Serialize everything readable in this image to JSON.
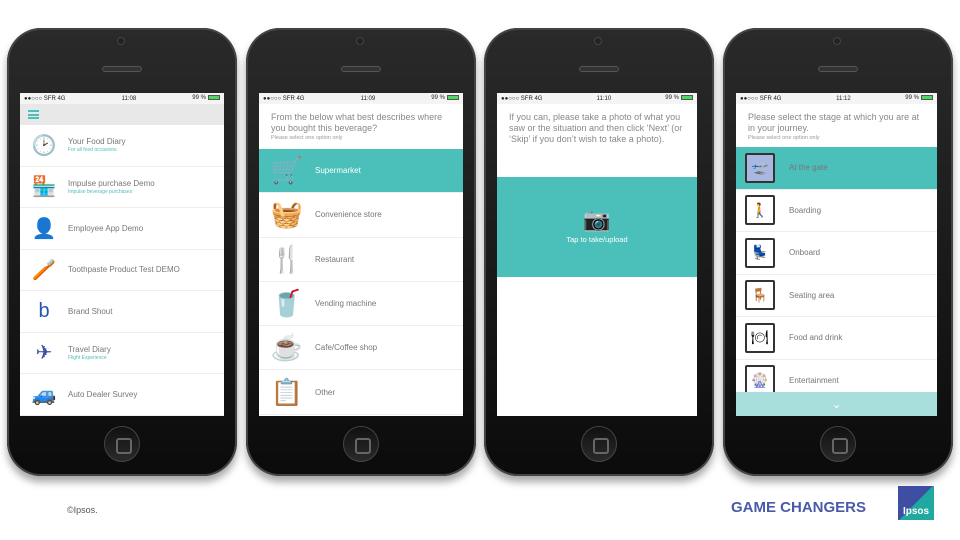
{
  "phones": [
    {
      "status": {
        "carrier": "●●○○○ SFR  4G",
        "time": "11:08",
        "battery": "99 %"
      }
    },
    {
      "status": {
        "carrier": "●●○○○ SFR  4G",
        "time": "11:09",
        "battery": "99 %"
      }
    },
    {
      "status": {
        "carrier": "●●○○○ SFR  4G",
        "time": "11:10",
        "battery": "99 %"
      }
    },
    {
      "status": {
        "carrier": "●●○○○ SFR  4G",
        "time": "11:12",
        "battery": "99 %"
      }
    }
  ],
  "projects": [
    {
      "title": "Your Food Diary",
      "subtitle": "For all food occasions",
      "icon": "clock-icon",
      "glyph": "🕑",
      "color": "#3e4fa3"
    },
    {
      "title": "Impulse purchase Demo",
      "subtitle": "Impulse beverage purchases",
      "icon": "shop-icon",
      "glyph": "🏪",
      "color": "#2b9b9a"
    },
    {
      "title": "Employee App Demo",
      "subtitle": "",
      "icon": "employee-icon",
      "glyph": "👤",
      "color": "#3e4fa3"
    },
    {
      "title": "Toothpaste Product Test DEMO",
      "subtitle": "",
      "icon": "toothbrush-icon",
      "glyph": "🪥",
      "color": "#44c23a"
    },
    {
      "title": "Brand Shout",
      "subtitle": "",
      "icon": "brand-shout-icon",
      "glyph": "b",
      "color": "#2456a8"
    },
    {
      "title": "Travel Diary",
      "subtitle": "Flight Experience",
      "icon": "plane-icon",
      "glyph": "✈",
      "color": "#3e4fa3"
    },
    {
      "title": "Auto Dealer Survey",
      "subtitle": "",
      "icon": "car-icon",
      "glyph": "🚙",
      "color": "#1e6bb8"
    }
  ],
  "purchase": {
    "question": "From the below what best describes where you bought this beverage?",
    "hint": "Please select one option only",
    "options": [
      {
        "label": "Supermarket",
        "icon": "shopping-cart-icon",
        "glyph": "🛒",
        "selected": true
      },
      {
        "label": "Convenience store",
        "icon": "basket-icon",
        "glyph": "🧺"
      },
      {
        "label": "Restaurant",
        "icon": "cutlery-icon",
        "glyph": "🍴"
      },
      {
        "label": "Vending machine",
        "icon": "vending-machine-icon",
        "glyph": "🥤"
      },
      {
        "label": "Cafe/Coffee shop",
        "icon": "coffee-cup-icon",
        "glyph": "☕"
      },
      {
        "label": "Other",
        "icon": "checklist-icon",
        "glyph": "📋"
      }
    ]
  },
  "photo": {
    "question": "If you can, please take a photo of what you saw or the situation and then click ‘Next’ (or ‘Skip’ if you don’t wish to take a photo).",
    "upload_label": "Tap to take/upload"
  },
  "journey": {
    "question": "Please select the stage at which you are at in your journey.",
    "hint": "Please select one option only",
    "options": [
      {
        "label": "At the gate",
        "icon": "gate-icon",
        "glyph": "🛫",
        "selected": true
      },
      {
        "label": "Boarding",
        "icon": "boarding-icon",
        "glyph": "🚶"
      },
      {
        "label": "Onboard",
        "icon": "onboard-seat-icon",
        "glyph": "💺"
      },
      {
        "label": "Seating area",
        "icon": "seating-area-icon",
        "glyph": "🪑"
      },
      {
        "label": "Food and drink",
        "icon": "plate-icon",
        "glyph": "🍽"
      },
      {
        "label": "Entertainment",
        "icon": "entertainment-icon",
        "glyph": "🎡"
      }
    ]
  },
  "footer": {
    "copyright": "©Ipsos.",
    "tagline": "GAME CHANGERS",
    "logo": "Ipsos"
  },
  "colors": {
    "accent": "#4bbfb9",
    "brand": "#4a5aa8"
  }
}
